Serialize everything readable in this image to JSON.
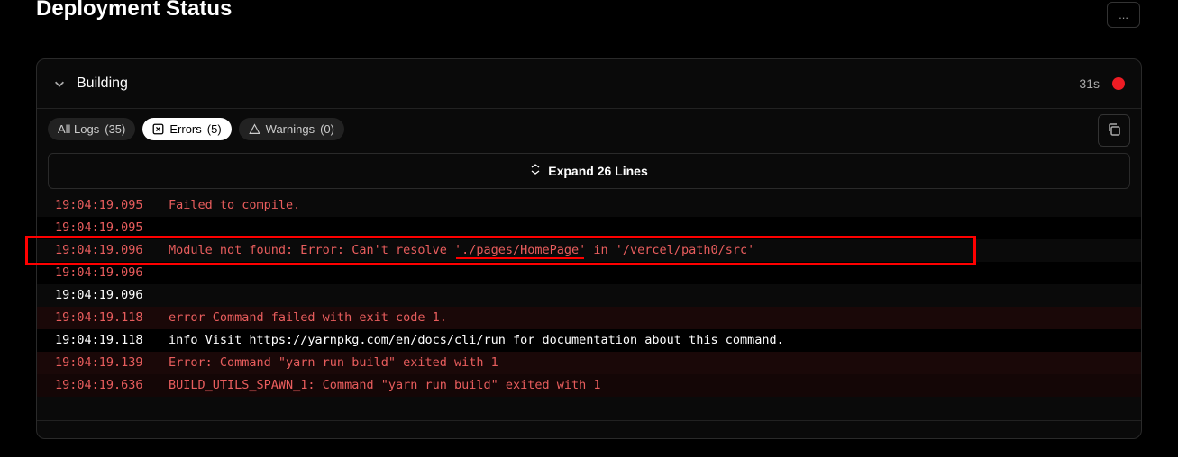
{
  "header": {
    "page_title": "Deployment Status",
    "top_right_button_label": "..."
  },
  "build": {
    "section_title": "Building",
    "duration": "31s",
    "status": "error"
  },
  "filters": {
    "all_label": "All Logs",
    "all_count": "(35)",
    "errors_label": "Errors",
    "errors_count": "(5)",
    "warnings_label": "Warnings",
    "warnings_count": "(0)"
  },
  "expand": {
    "label": "Expand 26 Lines"
  },
  "logs": [
    {
      "ts": "19:04:19.095",
      "msg": "Failed to compile.",
      "level": "error",
      "bg": "dark"
    },
    {
      "ts": "19:04:19.095",
      "msg": "",
      "level": "error",
      "bg": "darker"
    },
    {
      "ts": "19:04:19.096",
      "msg": "Module not found: Error: Can't resolve './pages/HomePage' in '/vercel/path0/src'",
      "level": "error",
      "bg": "dark"
    },
    {
      "ts": "19:04:19.096",
      "msg": "",
      "level": "error",
      "bg": "darker"
    },
    {
      "ts": "19:04:19.096",
      "msg": "",
      "level": "info-ts",
      "bg": "dark"
    },
    {
      "ts": "19:04:19.118",
      "msg": "error Command failed with exit code 1.",
      "level": "error",
      "bg": "error-bg"
    },
    {
      "ts": "19:04:19.118",
      "msg": "info Visit https://yarnpkg.com/en/docs/cli/run for documentation about this command.",
      "level": "info",
      "bg": "darker"
    },
    {
      "ts": "19:04:19.139",
      "msg": "Error: Command \"yarn run build\" exited with 1",
      "level": "error",
      "bg": "error-bg"
    },
    {
      "ts": "19:04:19.636",
      "msg": "BUILD_UTILS_SPAWN_1: Command \"yarn run build\" exited with 1",
      "level": "error",
      "bg": "error-bg-darker"
    }
  ],
  "annotations": {
    "highlight_row_index": 2,
    "underline_path": "./pages/HomePage"
  }
}
